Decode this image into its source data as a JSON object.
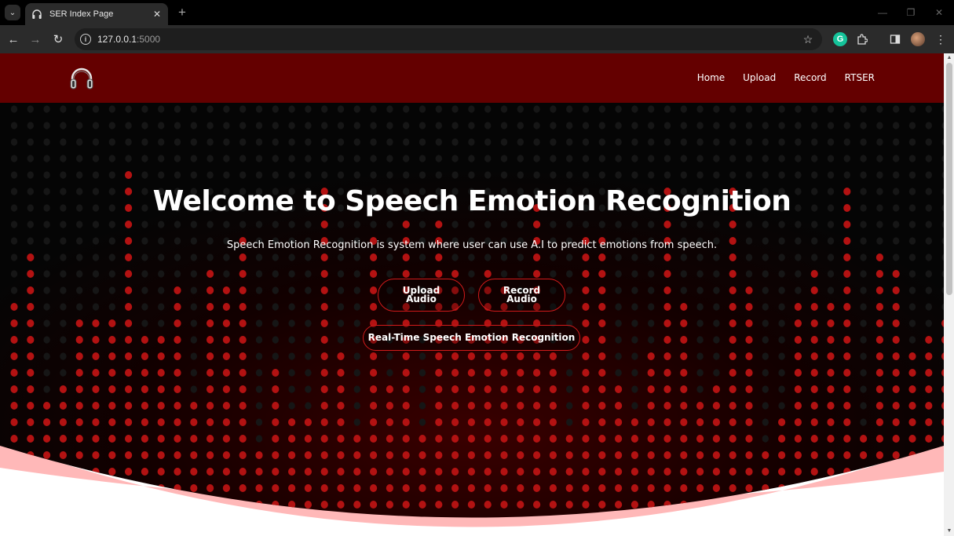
{
  "browser": {
    "tab_title": "SER Index Page",
    "url_host": "127.0.0.1",
    "url_port": ":5000"
  },
  "site": {
    "logo_icon": "headphones-icon",
    "nav": [
      {
        "label": "Home"
      },
      {
        "label": "Upload"
      },
      {
        "label": "Record"
      },
      {
        "label": "RTSER"
      }
    ]
  },
  "hero": {
    "title": "Welcome to Speech Emotion Recognition",
    "subtitle": "Speech Emotion Recognition is system where user can use A.I to predict emotions from speech.",
    "buttons": {
      "upload_line1": "Upload",
      "upload_line2": "Audio",
      "record_line1": "Record",
      "record_line2": "Audio",
      "rtser": "Real-Time Speech Emotion Recognition"
    }
  },
  "colors": {
    "header_bg": "#640000",
    "accent_red": "#d21a1a",
    "wave_pink": "#ffb8b8",
    "dot_red": "#b31212"
  }
}
